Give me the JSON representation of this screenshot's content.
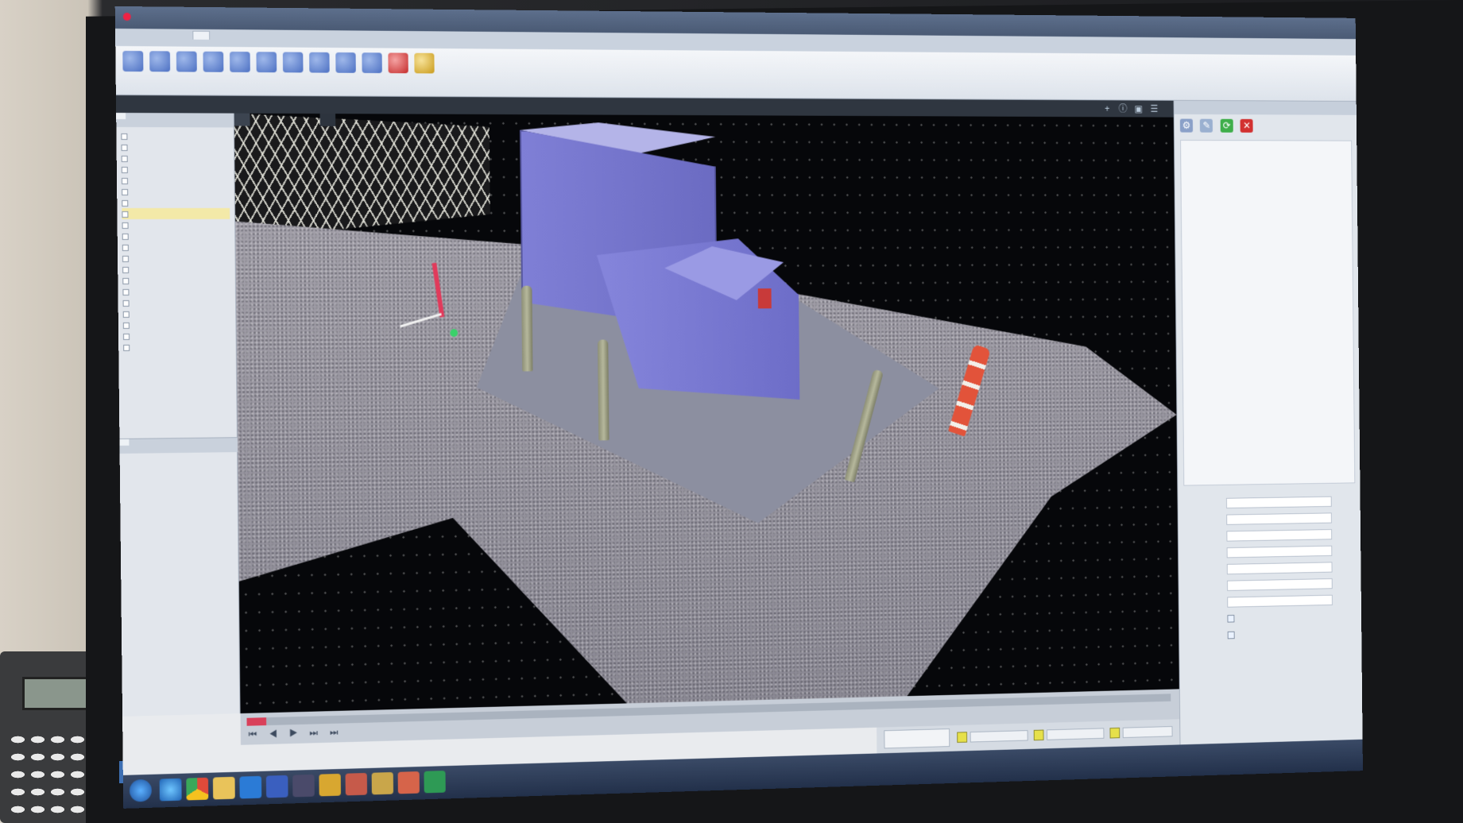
{
  "window": {
    "title": ""
  },
  "ribbon": {
    "tabs": [
      {
        "label": ""
      },
      {
        "label": ""
      },
      {
        "label": ""
      },
      {
        "label": ""
      },
      {
        "label": ""
      },
      {
        "label": ""
      }
    ],
    "buttons": [
      {
        "label": "",
        "icon": "select-icon"
      },
      {
        "label": "",
        "icon": "cursor-icon"
      },
      {
        "label": "",
        "icon": "orbit-icon"
      },
      {
        "label": "",
        "icon": "pan-icon"
      },
      {
        "label": "",
        "icon": "zoom-icon"
      },
      {
        "label": "",
        "icon": "zoom-in-icon"
      },
      {
        "label": "",
        "icon": "zoom-out-icon"
      },
      {
        "label": "",
        "icon": "fit-icon"
      },
      {
        "label": "",
        "icon": "rotate-icon"
      },
      {
        "label": "",
        "icon": "explode-icon"
      },
      {
        "label": "",
        "icon": "delete-icon"
      },
      {
        "label": "",
        "icon": "reset-icon"
      }
    ]
  },
  "left_panel": {
    "tabs": [
      {
        "label": ""
      },
      {
        "label": ""
      },
      {
        "label": ""
      }
    ],
    "tree": [
      {
        "label": ""
      },
      {
        "label": ""
      },
      {
        "label": ""
      },
      {
        "label": ""
      },
      {
        "label": ""
      },
      {
        "label": ""
      },
      {
        "label": ""
      },
      {
        "label": ""
      },
      {
        "label": ""
      },
      {
        "label": ""
      },
      {
        "label": ""
      },
      {
        "label": ""
      },
      {
        "label": ""
      },
      {
        "label": ""
      },
      {
        "label": ""
      },
      {
        "label": ""
      },
      {
        "label": ""
      },
      {
        "label": ""
      },
      {
        "label": ""
      },
      {
        "label": ""
      }
    ],
    "property_tabs": [
      {
        "label": ""
      },
      {
        "label": ""
      },
      {
        "label": ""
      }
    ],
    "properties": [
      {
        "key": "",
        "value": ""
      },
      {
        "key": "",
        "value": ""
      },
      {
        "key": "",
        "value": ""
      },
      {
        "key": "",
        "value": ""
      },
      {
        "key": "",
        "value": ""
      },
      {
        "key": "",
        "value": ""
      },
      {
        "key": "",
        "value": ""
      },
      {
        "key": "",
        "value": ""
      },
      {
        "key": "",
        "value": ""
      }
    ]
  },
  "viewport": {
    "tab_perspective": "",
    "tab_secondary": ""
  },
  "right_panel": {
    "header": "",
    "icons": [
      {
        "name": "settings-icon",
        "color": "#8aa0c8"
      },
      {
        "name": "paint-icon",
        "color": "#9ab0d0"
      },
      {
        "name": "refresh-icon",
        "color": "#3fae4a"
      },
      {
        "name": "close-icon",
        "color": "#d23030"
      }
    ],
    "settings": [
      {
        "label": "",
        "value": ""
      },
      {
        "label": "",
        "value": ""
      },
      {
        "label": "",
        "value": ""
      },
      {
        "label": "",
        "value": ""
      },
      {
        "label": "",
        "value": ""
      },
      {
        "label": "",
        "value": ""
      },
      {
        "label": "",
        "value": ""
      }
    ],
    "checkboxes": [
      {
        "label": ""
      },
      {
        "label": ""
      }
    ]
  },
  "timeline": {
    "position": 0.02
  },
  "bottom_bar": {
    "show_button": ""
  }
}
